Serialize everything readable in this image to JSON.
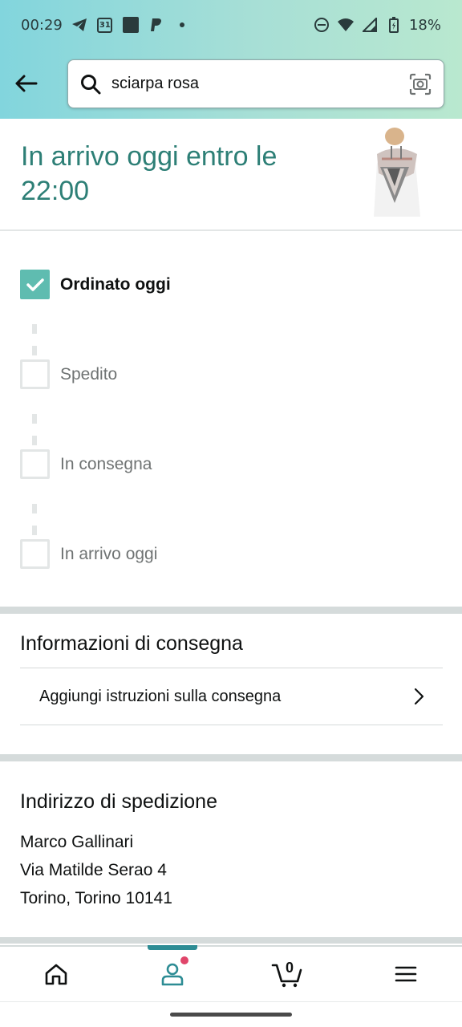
{
  "status_bar": {
    "time": "00:29",
    "calendar_day": "31",
    "battery_percent": "18%",
    "icons": [
      "telegram-icon",
      "calendar-icon",
      "app-square-icon",
      "paypal-icon",
      "notification-dot-icon",
      "do-not-disturb-icon",
      "wifi-icon",
      "signal-icon",
      "battery-charging-icon"
    ]
  },
  "search": {
    "value": "sciarpa rosa",
    "placeholder": ""
  },
  "arrival": {
    "title": "In arrivo oggi entro le 22:00"
  },
  "tracker": {
    "steps": [
      {
        "label": "Ordinato oggi",
        "done": true
      },
      {
        "label": "Spedito",
        "done": false
      },
      {
        "label": "In consegna",
        "done": false
      },
      {
        "label": "In arrivo oggi",
        "done": false
      }
    ]
  },
  "delivery_info": {
    "title": "Informazioni di consegna",
    "add_instructions": "Aggiungi istruzioni sulla consegna"
  },
  "shipping": {
    "title": "Indirizzo di spedizione",
    "name": "Marco Gallinari",
    "street": "Via Matilde Serao 4",
    "city": "Torino, Torino 10141"
  },
  "bottom_nav": {
    "items": [
      "home-icon",
      "account-icon",
      "cart-icon",
      "menu-icon"
    ],
    "active": "account-icon",
    "cart_count": "0"
  },
  "colors": {
    "accent_teal": "#2d7f76",
    "checkbox_done": "#5fbcb0",
    "nav_active": "#2d8c94",
    "notification_dot": "#e0456a"
  }
}
